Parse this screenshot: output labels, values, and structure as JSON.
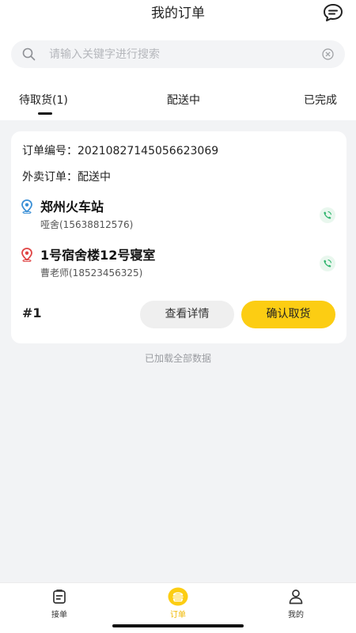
{
  "header": {
    "title": "我的订单"
  },
  "search": {
    "placeholder": "请输入关键字进行搜索",
    "value": ""
  },
  "tabs": [
    {
      "label": "待取货(1)",
      "active": true
    },
    {
      "label": "配送中",
      "active": false
    },
    {
      "label": "已完成",
      "active": false
    }
  ],
  "order": {
    "number_label": "订单编号：",
    "number": "20210827145056623069",
    "type_label": "外卖订单：",
    "type_status": "配送中",
    "pickup": {
      "place": "郑州火车站",
      "contact": "哑舍(15638812576)"
    },
    "dropoff": {
      "place": "1号宿舍楼12号寝室",
      "contact": "曹老师(18523456325)"
    },
    "seq": "#1",
    "detail_button": "查看详情",
    "confirm_button": "确认取货"
  },
  "list_footer": "已加载全部数据",
  "bottom_nav": [
    {
      "label": "接单",
      "icon": "clipboard-icon"
    },
    {
      "label": "订单",
      "icon": "burger-icon",
      "active": true
    },
    {
      "label": "我的",
      "icon": "person-icon"
    }
  ],
  "colors": {
    "accent": "#fccd13",
    "accent_text": "#f0b800",
    "pickup_pin": "#3a8fd6",
    "dropoff_pin": "#e04545",
    "phone": "#2bb36a",
    "background": "#f2f3f5"
  }
}
